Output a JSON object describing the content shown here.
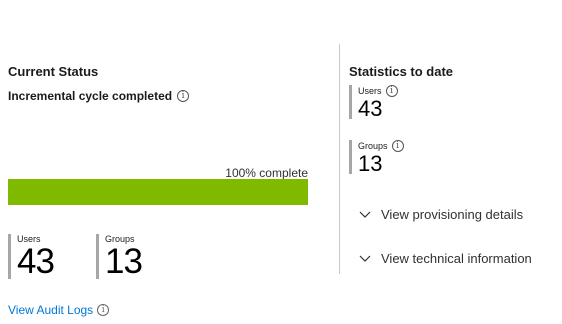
{
  "current_status": {
    "title": "Current Status",
    "cycle_label": "Incremental cycle completed",
    "progress_label": "100% complete",
    "progress_fraction": 1.0,
    "progress_color": "#7fba00",
    "stats": [
      {
        "label": "Users",
        "value": "43"
      },
      {
        "label": "Groups",
        "value": "13"
      }
    ],
    "audit_link": "View Audit Logs"
  },
  "statistics": {
    "title": "Statistics to date",
    "stats": [
      {
        "label": "Users",
        "value": "43"
      },
      {
        "label": "Groups",
        "value": "13"
      }
    ],
    "expanders": [
      {
        "label": "View provisioning details",
        "icon": "chevron-down-icon"
      },
      {
        "label": "View technical information",
        "icon": "chevron-down-icon"
      }
    ]
  },
  "icons": {
    "info": "info-icon"
  }
}
